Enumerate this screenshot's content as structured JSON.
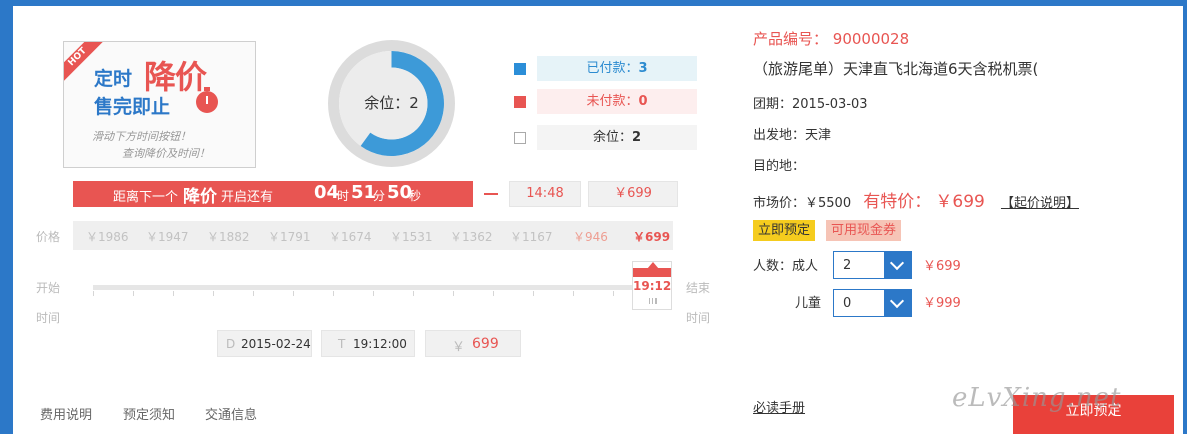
{
  "promo": {
    "ribbon": "HOT",
    "line1a": "定时",
    "line1b": "降价",
    "line2": "售完即止",
    "hint1": "滑动下方时间按钮！",
    "hint2": "查询降价及时间！"
  },
  "seats": {
    "label": "余位：2",
    "paid_fraction": 0.6
  },
  "legend": [
    {
      "label": "已付款：",
      "value": "3",
      "color": "#2b8ed8",
      "bg": "#e6f3f8",
      "text_color": "#2c8bd0"
    },
    {
      "label": "未付款：",
      "value": "0",
      "color": "#e85552",
      "bg": "#fdeeee",
      "text_color": "#e85552"
    },
    {
      "label": "余位：",
      "value": "2",
      "color": "#ffffff",
      "bg": "#f4f4f4",
      "text_color": "#333333"
    }
  ],
  "countdown": {
    "prefix": "距离下一个",
    "highlight": "降价",
    "suffix": "开启还有",
    "hours": "04",
    "hours_unit": "时",
    "minutes": "51",
    "minutes_unit": "分",
    "seconds": "50",
    "seconds_unit": "秒",
    "next_time": "14:48",
    "next_price": "￥699"
  },
  "prices": {
    "label": "价格",
    "steps": [
      "￥1986",
      "￥1947",
      "￥1882",
      "￥1791",
      "￥1674",
      "￥1531",
      "￥1362",
      "￥1167",
      "￥946",
      "￥699"
    ]
  },
  "timeline": {
    "start_label": "开始",
    "end_label": "结束",
    "time_label": "时间",
    "slider_time": "19:12",
    "position": 1.0
  },
  "selection": {
    "date_prefix": "D",
    "date": "2015-02-24",
    "time_prefix": "T",
    "time": "19:12:00",
    "price_prefix": "￥",
    "price": "699"
  },
  "tabs": [
    "费用说明",
    "预定须知",
    "交通信息"
  ],
  "product": {
    "code_label": "产品编号：",
    "code": "90000028",
    "title": "（旅游尾单）天津直飞北海道6天含税机票(",
    "group_date": "团期：2015-03-03",
    "departure": "出发地：天津",
    "destination": "目的地：",
    "market_price": "市场价：￥5500",
    "special_label": "有特价：",
    "special_price": "￥699",
    "price_note": "【起价说明】",
    "book_badge": "立即预定",
    "coupon_badge": "可用现金券",
    "adult_label": "人数：成人",
    "adult_count": "2",
    "adult_price": "￥699",
    "child_label": "儿童",
    "child_count": "0",
    "child_price": "￥999",
    "must_read": "必读手册",
    "book_button": "立即预定"
  },
  "watermark": "eLvXing.net"
}
